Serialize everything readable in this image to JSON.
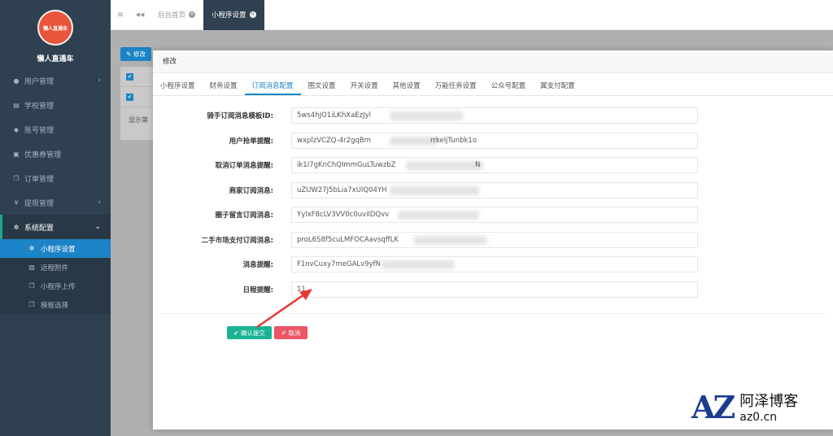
{
  "sidebar": {
    "brand": "懒人直通车",
    "logo_text": "懒人直通车",
    "items": [
      {
        "label": "用户管理",
        "icon": "user-icon",
        "chevron": "‹"
      },
      {
        "label": "学校管理",
        "icon": "book-icon",
        "chevron": ""
      },
      {
        "label": "账号管理",
        "icon": "users-icon",
        "chevron": ""
      },
      {
        "label": "优惠券管理",
        "icon": "coupon-icon",
        "chevron": ""
      },
      {
        "label": "订单管理",
        "icon": "copy-icon",
        "chevron": ""
      },
      {
        "label": "提现管理",
        "icon": "yen-icon",
        "chevron": "‹"
      },
      {
        "label": "系统配置",
        "icon": "gear-icon",
        "chevron": "⌄"
      }
    ],
    "subitems": [
      {
        "label": "小程序设置",
        "icon": "gear-icon"
      },
      {
        "label": "远程附件",
        "icon": "image-icon"
      },
      {
        "label": "小程序上传",
        "icon": "copy-icon"
      },
      {
        "label": "模板选择",
        "icon": "copy-icon"
      }
    ]
  },
  "topbar": {
    "menu_icon": "≡",
    "back_icon": "◀◀",
    "tabs": [
      {
        "label": "后台首页"
      },
      {
        "label": "小程序设置"
      }
    ]
  },
  "background": {
    "edit_button": "✎ 修改",
    "footer_text": "显示第"
  },
  "modal": {
    "title": "修改",
    "tabs": [
      "小程序设置",
      "财务设置",
      "订阅消息配置",
      "图文设置",
      "开关设置",
      "其他设置",
      "万能任务设置",
      "公众号配置",
      "翼支付配置"
    ],
    "active_tab": "订阅消息配置",
    "fields": [
      {
        "label": "骑手订阅消息模板ID:",
        "value": "5ws4hJO1iLKhXaEzJyl"
      },
      {
        "label": "用户抢单提醒:",
        "value": "wxplzVCZQ-4r2gqBm",
        "suffix": "rrkeljTunbk1o"
      },
      {
        "label": "取消订单消息提醒:",
        "value": "ik1I7gKnChQImmGuLTuwzbZ",
        "suffix": "N"
      },
      {
        "label": "商家订阅消息:",
        "value": "uZUW27J5bLia7xUIQ04YH",
        "suffix": ""
      },
      {
        "label": "圈子留言订阅消息:",
        "value": "YylxF8cLV3VV0c0uvilDQvv",
        "suffix": ""
      },
      {
        "label": "二手市场支付订阅消息:",
        "value": "proL6S8f5cuLMFOCAavsqffLK",
        "suffix": ""
      },
      {
        "label": "消息提醒:",
        "value": "F1nvCuxy7meGALv9yfN",
        "suffix": ""
      },
      {
        "label": "日程提醒:",
        "value": "11",
        "suffix": ""
      }
    ],
    "confirm_button": "✔ 确认提交",
    "cancel_button": "✐ 取消"
  },
  "watermark": {
    "logo": "AZ",
    "name": "阿泽博客",
    "url": "az0.cn"
  },
  "colors": {
    "sidebar": "#2f4050",
    "primary": "#1c84c6",
    "success": "#1ab394",
    "danger": "#ed5565",
    "arrow": "#e53935"
  }
}
